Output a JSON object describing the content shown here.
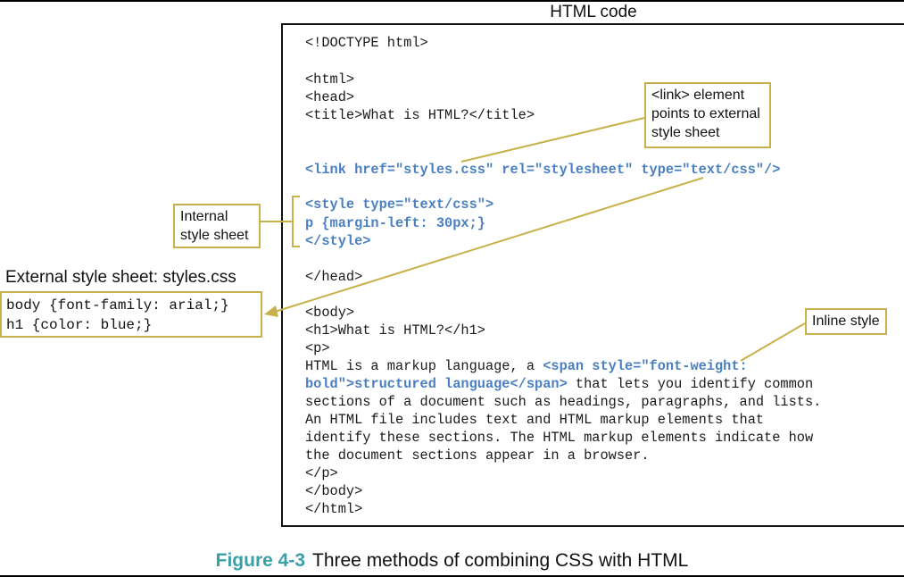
{
  "header": {
    "code_title": "HTML code"
  },
  "code_lines": [
    {
      "text": "<!DOCTYPE html>",
      "style": "plain"
    },
    {
      "text": "<html>",
      "style": "plain"
    },
    {
      "text": "<head>",
      "style": "plain"
    },
    {
      "text": "<title>What is HTML?</title>",
      "style": "plain"
    },
    {
      "text": "<link href=\"styles.css\" rel=\"stylesheet\" type=\"text/css\"/>",
      "style": "blue"
    },
    {
      "text": "<style type=\"text/css\">",
      "style": "blue"
    },
    {
      "text": "p {margin-left: 30px;}",
      "style": "blue"
    },
    {
      "text": "</style>",
      "style": "blue"
    },
    {
      "text": "</head>",
      "style": "plain"
    },
    {
      "text": "<body>",
      "style": "plain"
    },
    {
      "text": "<h1>What is HTML?</h1>",
      "style": "plain"
    },
    {
      "text": "<p>",
      "style": "plain"
    },
    {
      "text": "HTML is a markup language, a ",
      "style": "plain"
    },
    {
      "text": "<span style=\"font-weight:",
      "style": "blue"
    },
    {
      "text": "bold\">structured language</span>",
      "style": "blue"
    },
    {
      "text": " that lets you identify common",
      "style": "plain"
    },
    {
      "text": "sections of a document such as headings, paragraphs, and lists.",
      "style": "plain"
    },
    {
      "text": "An HTML file includes text and HTML markup elements that",
      "style": "plain"
    },
    {
      "text": "identify these sections. The HTML markup elements indicate how",
      "style": "plain"
    },
    {
      "text": "the document sections appear in a browser.",
      "style": "plain"
    },
    {
      "text": "</p>",
      "style": "plain"
    },
    {
      "text": "</body>",
      "style": "plain"
    },
    {
      "text": "</html>",
      "style": "plain"
    }
  ],
  "callouts": {
    "link_element": [
      "<link> element",
      "points to external",
      "style sheet"
    ],
    "internal": [
      "Internal",
      "style sheet"
    ],
    "inline": "Inline style"
  },
  "external": {
    "label": "External style sheet: styles.css",
    "lines": [
      "body {font-family: arial;}",
      "h1 {color: blue;}"
    ]
  },
  "caption": {
    "figure_number": "Figure 4-3",
    "text": "Three methods of combining CSS with HTML"
  },
  "colors": {
    "callout_border": "#c8b04a",
    "code_blue": "#4a7fc0",
    "figure_teal": "#3aa0a8"
  }
}
